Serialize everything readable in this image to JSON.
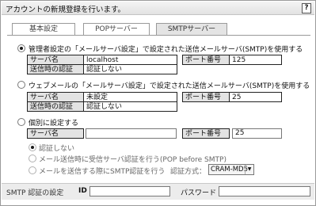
{
  "title": "アカウントの新規登録を行います。",
  "help_label": "?",
  "tabs": [
    {
      "label": "基本設定",
      "active": false
    },
    {
      "label": "POPサーバー",
      "active": false
    },
    {
      "label": "SMTPサーバー",
      "active": true
    }
  ],
  "option1": {
    "label": "管理者設定の「メールサーバ設定」で設定された送信メールサーバ(SMTP)を使用する",
    "selected": true,
    "server_name_label": "サーバ名",
    "server_name_value": "localhost",
    "port_label": "ポート番号",
    "port_value": "125",
    "auth_label": "送信時の認証",
    "auth_value": "認証しない"
  },
  "option2": {
    "label": "ウェブメールの「メールサーバ設定」で設定された送信メールサーバ(SMTP)を使用する",
    "selected": false,
    "server_name_label": "サーバ名",
    "server_name_value": "未設定",
    "port_label": "ポート番号",
    "port_value": "25",
    "auth_label": "送信時の認証",
    "auth_value": "認証しない"
  },
  "option3": {
    "label": "個別に設定する",
    "selected": false,
    "server_name_label": "サーバ名",
    "server_name_value": "",
    "port_label": "ポート番号",
    "port_value": "25",
    "auth_options": [
      {
        "label": "認証しない",
        "selected": true
      },
      {
        "label": "メール送信時に受信サーバ認証を行う(POP before SMTP)",
        "selected": false
      },
      {
        "label": "メールを送信する際にSMTP認証を行う",
        "selected": false
      }
    ],
    "auth_method_label": "認証方式：",
    "auth_method_value": "CRAM-MD5"
  },
  "footer": {
    "section_label": "SMTP 認証の設定",
    "id_label": "ID",
    "id_value": "",
    "password_label": "パスワード",
    "password_value": ""
  }
}
